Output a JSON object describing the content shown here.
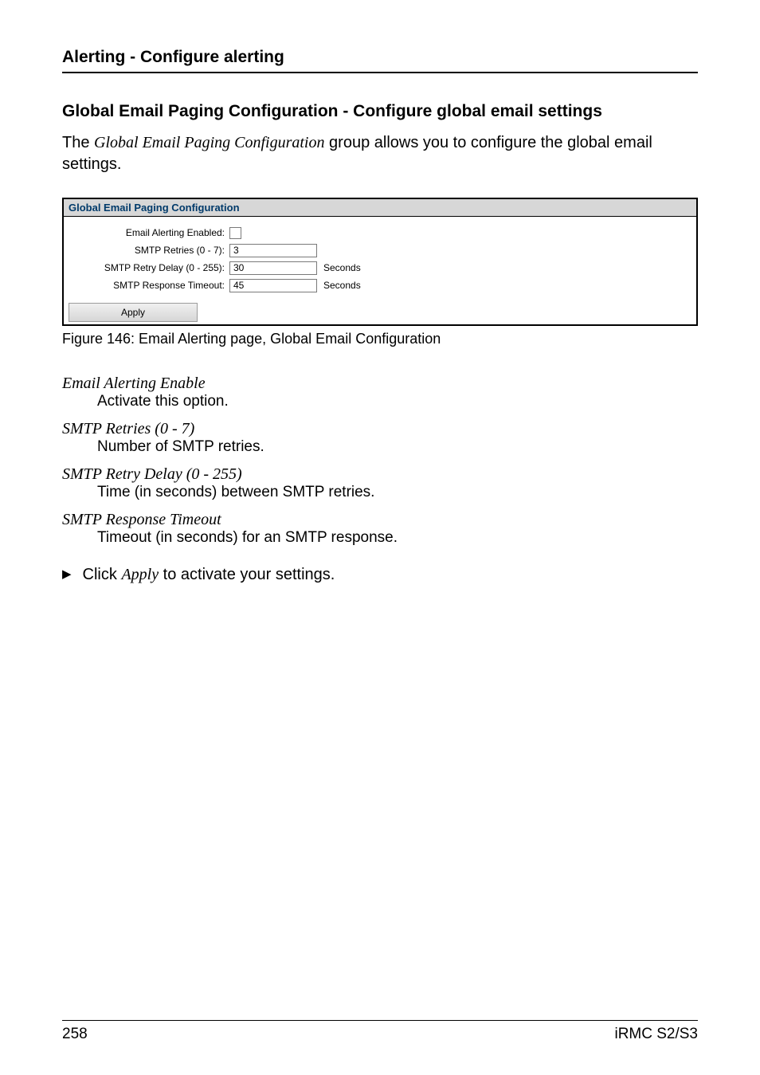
{
  "header": {
    "title": "Alerting - Configure alerting"
  },
  "section": {
    "title": "Global Email Paging Configuration - Configure global email settings",
    "intro_prefix": "The ",
    "intro_italic": "Global Email Paging Configuration",
    "intro_suffix": " group allows you to configure the global email settings."
  },
  "screenshot": {
    "panel_title": "Global Email Paging Configuration",
    "rows": {
      "enabled_label": "Email Alerting Enabled:",
      "retries_label": "SMTP Retries (0 - 7):",
      "retries_value": "3",
      "retry_delay_label": "SMTP Retry Delay (0 - 255):",
      "retry_delay_value": "30",
      "retry_delay_units": "Seconds",
      "timeout_label": "SMTP Response Timeout:",
      "timeout_value": "45",
      "timeout_units": "Seconds"
    },
    "apply_label": "Apply"
  },
  "figure_caption": "Figure 146: Email Alerting page, Global Email Configuration",
  "definitions": [
    {
      "term": "Email Alerting Enable",
      "desc": "Activate this option."
    },
    {
      "term": "SMTP Retries (0 - 7)",
      "desc": "Number of SMTP retries."
    },
    {
      "term": "SMTP Retry Delay (0 - 255)",
      "desc": "Time (in seconds) between SMTP retries."
    },
    {
      "term": "SMTP Response Timeout",
      "desc": "Timeout (in seconds) for an SMTP response."
    }
  ],
  "action": {
    "bullet": "▶",
    "prefix": "Click ",
    "italic": "Apply",
    "suffix": " to activate your settings."
  },
  "footer": {
    "left": "258",
    "right": "iRMC S2/S3"
  }
}
